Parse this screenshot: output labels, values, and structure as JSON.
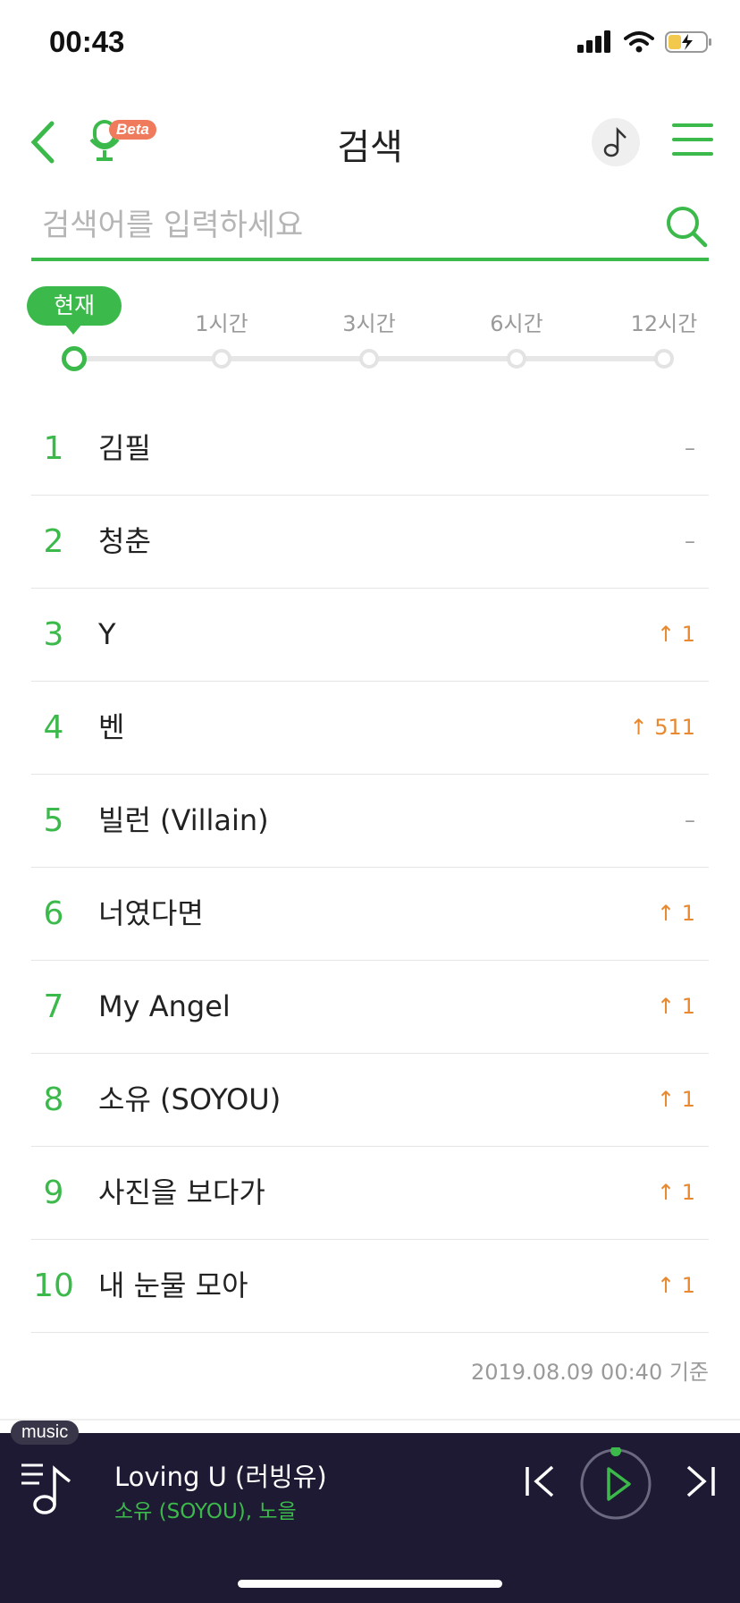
{
  "status_bar": {
    "time": "00:43"
  },
  "header": {
    "title": "검색",
    "beta_badge": "Beta"
  },
  "search": {
    "placeholder": "검색어를 입력하세요"
  },
  "time_tabs": [
    {
      "label": "현재",
      "active": true
    },
    {
      "label": "1시간",
      "active": false
    },
    {
      "label": "3시간",
      "active": false
    },
    {
      "label": "6시간",
      "active": false
    },
    {
      "label": "12시간",
      "active": false
    }
  ],
  "rankings": [
    {
      "rank": "1",
      "keyword": "김필",
      "change": "–",
      "trend": "same"
    },
    {
      "rank": "2",
      "keyword": "청춘",
      "change": "–",
      "trend": "same"
    },
    {
      "rank": "3",
      "keyword": "Y",
      "change": "↑ 1",
      "trend": "up"
    },
    {
      "rank": "4",
      "keyword": "벤",
      "change": "↑ 511",
      "trend": "up"
    },
    {
      "rank": "5",
      "keyword": "빌런 (Villain)",
      "change": "–",
      "trend": "same"
    },
    {
      "rank": "6",
      "keyword": "너였다면",
      "change": "↑ 1",
      "trend": "up"
    },
    {
      "rank": "7",
      "keyword": "My Angel",
      "change": "↑ 1",
      "trend": "up"
    },
    {
      "rank": "8",
      "keyword": "소유 (SOYOU)",
      "change": "↑ 1",
      "trend": "up"
    },
    {
      "rank": "9",
      "keyword": "사진을 보다가",
      "change": "↑ 1",
      "trend": "up"
    },
    {
      "rank": "10",
      "keyword": "내 눈물 모아",
      "change": "↑ 1",
      "trend": "up"
    }
  ],
  "timestamp": "2019.08.09 00:40 기준",
  "player": {
    "tag": "music",
    "song_title": "Loving U (러빙유)",
    "artist": "소유 (SOYOU), 노을"
  },
  "colors": {
    "accent": "#3cb94b",
    "up": "#e8882f",
    "player_bg": "#1e1a33"
  }
}
